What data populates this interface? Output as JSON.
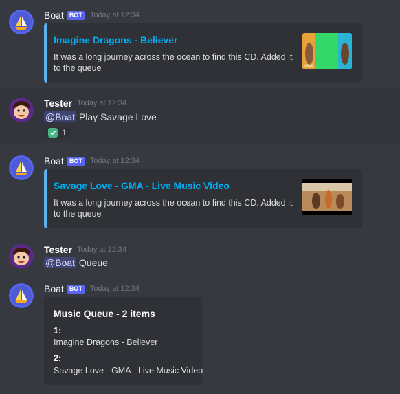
{
  "colors": {
    "background": "#36393f",
    "embed_bg": "#2f3136",
    "accent_link": "#00aff4",
    "embed_border": "#5eb1f0",
    "bot_tag": "#5865f2"
  },
  "messages": [
    {
      "author": "Boat",
      "bot_tag": "BOT",
      "timestamp": "Today at 12:34",
      "embed": {
        "title": "Imagine Dragons - Believer",
        "description": "It was a long journey across the ocean to find this CD. Added it to the queue",
        "thumbnail_label": "vevo"
      }
    },
    {
      "author": "Tester",
      "timestamp": "Today at 12:34",
      "mention": "@Boat",
      "text": "Play Savage Love",
      "reaction": {
        "emoji": "check-mark",
        "count": "1"
      }
    },
    {
      "author": "Boat",
      "bot_tag": "BOT",
      "timestamp": "Today at 12:34",
      "embed": {
        "title": "Savage Love - GMA - Live Music Video",
        "description": "It was a long journey across the ocean to find this CD. Added it to the queue"
      }
    },
    {
      "author": "Tester",
      "timestamp": "Today at 12:34",
      "mention": "@Boat",
      "text": "Queue"
    },
    {
      "author": "Boat",
      "bot_tag": "BOT",
      "timestamp": "Today at 12:34",
      "queue": {
        "title": "Music Queue - 2 items",
        "items": [
          {
            "num": "1:",
            "name": "Imagine Dragons - Believer"
          },
          {
            "num": "2:",
            "name": "Savage Love - GMA - Live Music Video"
          }
        ]
      }
    }
  ]
}
